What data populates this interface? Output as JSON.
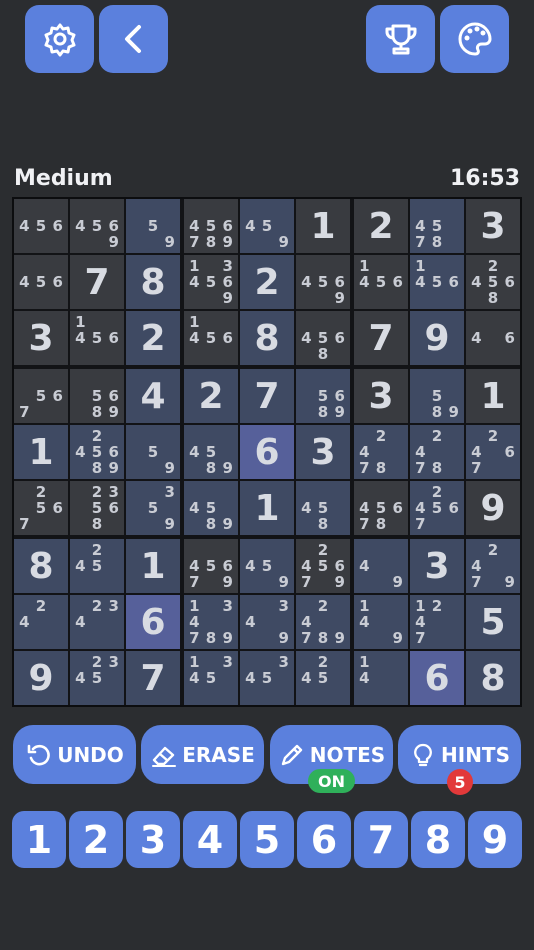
{
  "header": {
    "settings_icon": "gear-icon",
    "back_icon": "chevron-left-icon",
    "trophy_icon": "trophy-icon",
    "palette_icon": "palette-icon"
  },
  "info": {
    "difficulty": "Medium",
    "timer": "16:53"
  },
  "colors": {
    "button": "#5b80dd",
    "cell": "#393b40",
    "highlight": "#3f4a63",
    "selected": "#56609a",
    "on_badge": "#2fb05a",
    "hint_badge": "#e2393a"
  },
  "board": {
    "selected_value": "6",
    "rows": [
      [
        "n:456",
        "n:4569",
        "n:59",
        "n:456789",
        "n:459",
        "1",
        "2",
        "n:4578",
        "3"
      ],
      [
        "n:456",
        "7",
        "8",
        "n:134569",
        "2",
        "n:4569",
        "n:1456",
        "n:1456",
        "n:24568"
      ],
      [
        "3",
        "n:1456",
        "2",
        "n:1456",
        "8",
        "n:4568",
        "7",
        "9",
        "n:46"
      ],
      [
        "n:567",
        "n:5689",
        "4",
        "2",
        "7",
        "n:5689",
        "3",
        "n:589",
        "1"
      ],
      [
        "1",
        "n:245689",
        "n:59",
        "n:4589",
        "6",
        "3",
        "n:2478",
        "n:2478",
        "n:2467"
      ],
      [
        "n:2567",
        "n:23568",
        "n:359",
        "n:4589",
        "1",
        "n:458",
        "n:45678",
        "n:24567",
        "9"
      ],
      [
        "8",
        "n:245",
        "1",
        "n:45679",
        "n:459",
        "n:245679",
        "n:49",
        "3",
        "n:2479"
      ],
      [
        "n:24",
        "n:234",
        "6",
        "n:134789",
        "n:349",
        "n:24789",
        "n:149",
        "n:1247",
        "5"
      ],
      [
        "9",
        "n:2345",
        "7",
        "n:1345",
        "n:345",
        "n:245",
        "n:14",
        "6",
        "8"
      ]
    ]
  },
  "controls": {
    "undo_label": "UNDO",
    "erase_label": "ERASE",
    "notes_label": "NOTES",
    "notes_state": "ON",
    "hints_label": "HINTS",
    "hints_count": "5"
  },
  "numpad": [
    "1",
    "2",
    "3",
    "4",
    "5",
    "6",
    "7",
    "8",
    "9"
  ]
}
